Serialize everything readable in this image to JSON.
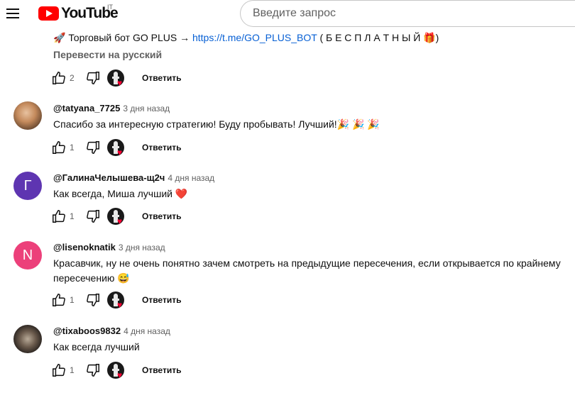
{
  "header": {
    "logo_text": "YouTube",
    "country_code": "IT",
    "search_placeholder": "Введите запрос"
  },
  "comments": [
    {
      "text_prefix": "🚀 Торговый бот GO PLUS → ",
      "link": "https://t.me/GO_PLUS_BOT",
      "text_suffix": " ( Б Е С П Л А Т Н Ы Й 🎁)",
      "translate_label": "Перевести на русский",
      "likes": "2",
      "reply_label": "Ответить"
    },
    {
      "author": "@tatyana_7725",
      "time": "3 дня назад",
      "text": "Спасибо за интересную стратегию! Буду пробывать! Лучший!🎉 🎉 🎉",
      "likes": "1",
      "reply_label": "Ответить",
      "avatar_color": "#a8785a"
    },
    {
      "author": "@ГалинаЧелышева-щ2ч",
      "time": "4 дня назад",
      "text": "Как всегда, Миша лучший ❤️",
      "likes": "1",
      "reply_label": "Ответить",
      "avatar_letter": "Г",
      "avatar_color": "#5e35b1"
    },
    {
      "author": "@lisenoknatik",
      "time": "3 дня назад",
      "text": "Красавчик, ну не очень понятно  зачем смотреть на предыдущие пересечения, если открывается по крайнему пересечению 😅",
      "likes": "1",
      "reply_label": "Ответить",
      "avatar_letter": "N",
      "avatar_color": "#ec407a"
    },
    {
      "author": "@tixaboos9832",
      "time": "4 дня назад",
      "text": "Как всегда лучший",
      "likes": "1",
      "reply_label": "Ответить",
      "avatar_color": "#3a3330"
    }
  ]
}
